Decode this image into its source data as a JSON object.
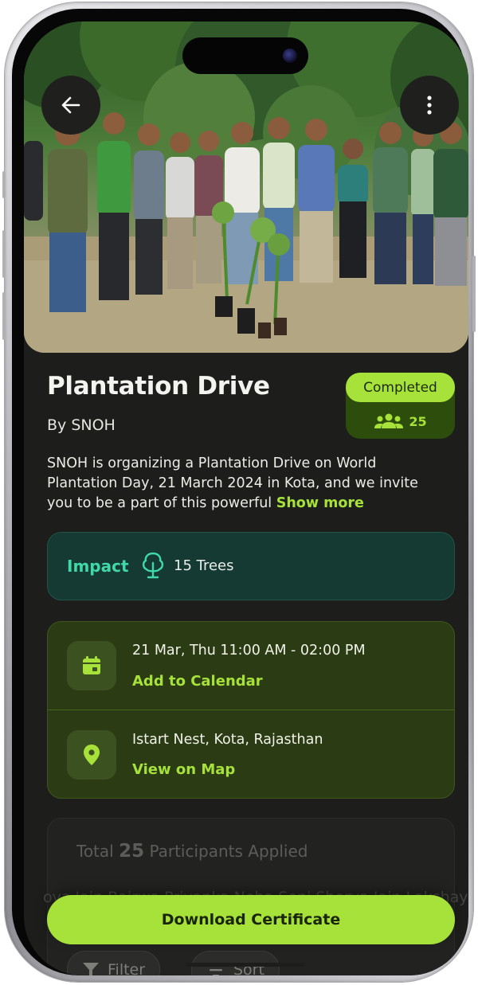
{
  "event": {
    "title": "Plantation Drive",
    "organizer": "By SNOH",
    "status": "Completed",
    "participant_count": "25",
    "description": "SNOH is organizing a Plantation Drive on World Plantation Day, 21 March 2024 in Kota, and we invite you to be a part of this powerful",
    "show_more_label": "Show more"
  },
  "impact": {
    "label": "Impact",
    "value": "15 Trees",
    "icon": "tree-icon"
  },
  "schedule": {
    "datetime": "21 Mar, Thu 11:00 AM - 02:00 PM",
    "action_label": "Add to Calendar",
    "icon": "calendar-icon"
  },
  "location": {
    "address": "Istart Nest, Kota, Rajasthan",
    "action_label": "View on Map",
    "icon": "location-pin-icon"
  },
  "participants": {
    "prefix": "Total",
    "count": "25",
    "suffix": "Participants Applied",
    "names_preview": "ova Jain  Bairwa  Priyanka  Neha Soni   Sherya Jain  Lakshay",
    "filter_label": "Filter",
    "sort_label": "Sort"
  },
  "actions": {
    "download_label": "Download Certificate"
  },
  "colors": {
    "accent": "#a6e23a",
    "impact_text": "#41d8a8",
    "background": "#1d1e1b"
  }
}
